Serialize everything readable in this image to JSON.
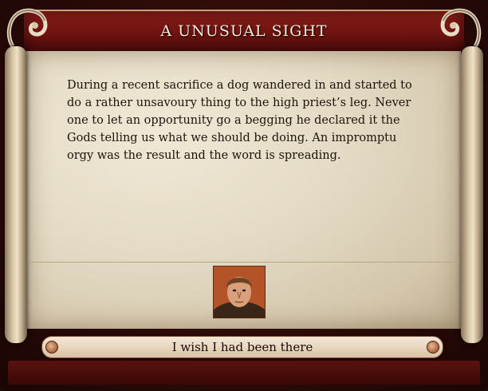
{
  "window": {
    "title": "A UNUSUAL SIGHT"
  },
  "event": {
    "description": "During a recent sacrifice a dog wandered in and started to do a rather unsavoury thing to the high priest’s leg. Never one to let an opportunity go a begging he declared it the Gods telling us what we should be doing. An impromptu orgy was the result and the word is spreading."
  },
  "portrait": {
    "icon": "character-portrait"
  },
  "options": [
    {
      "label": "I wish I had been there"
    }
  ],
  "colors": {
    "title_band": "#7a1714",
    "parchment": "#e6dcc6",
    "button_fill": "#e8d6c0",
    "text": "#1c140c"
  }
}
